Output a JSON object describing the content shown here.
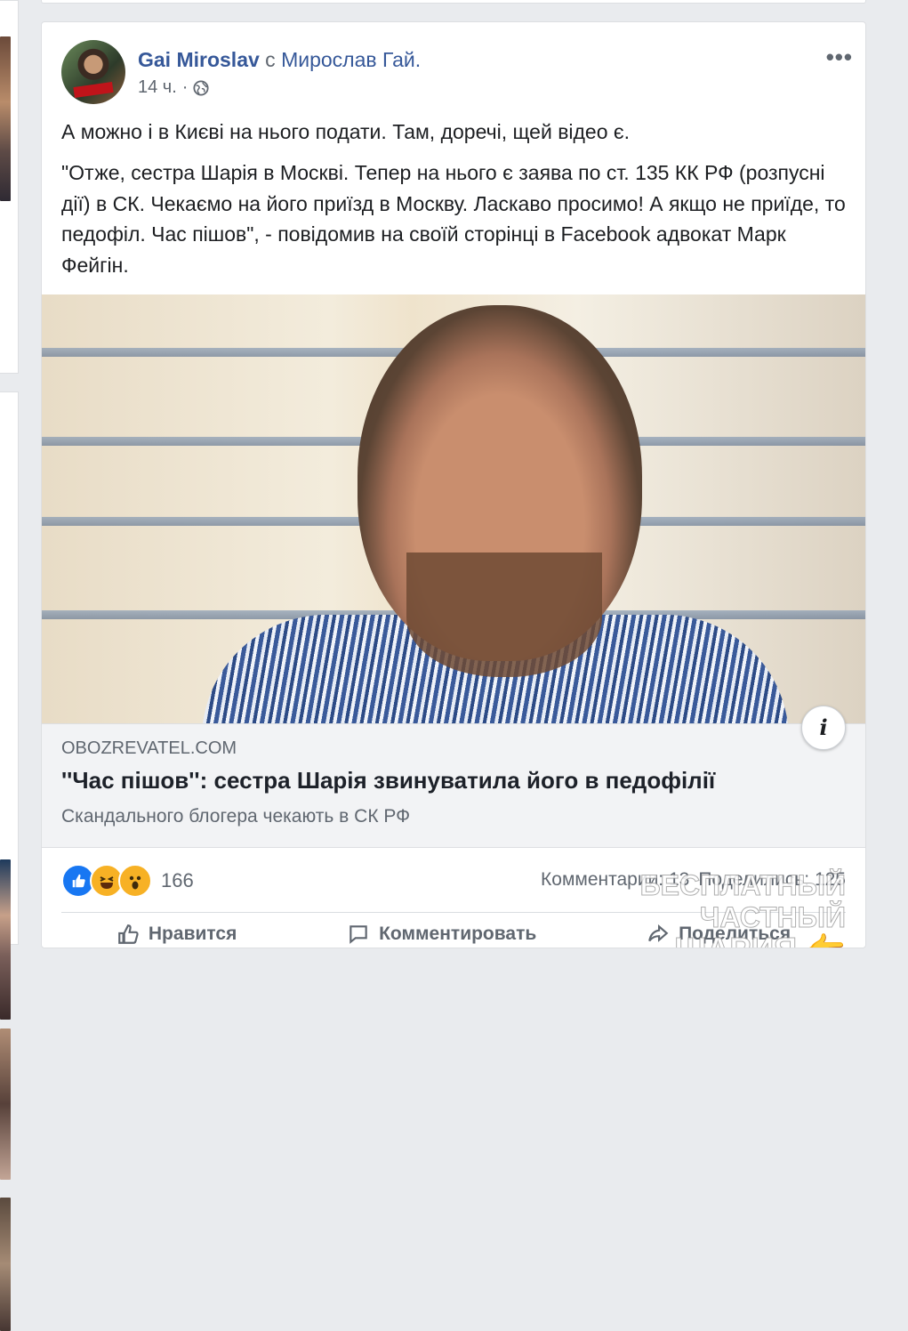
{
  "post": {
    "author": "Gai Miroslav",
    "with_label": "с",
    "with_name": "Мирослав Гай.",
    "time": "14 ч.",
    "dot": "·",
    "privacy_icon": "globe-icon",
    "more_label": "•••",
    "text_1": "А можно і в Києві на нього подати. Там, доречі, щей відео є.",
    "text_2": "\"Отже, сестра Шарія в Москві. Тепер на нього є заява по ст. 135 КК РФ (розпусні дії) в СК. Чекаємо на його приїзд в Москву. Ласкаво просимо! А якщо не приїде, то педофіл. Час пішов\", - повідомив на своїй сторінці в Facebook адвокат Марк Фейгін."
  },
  "link": {
    "info_label": "i",
    "domain": "OBOZREVATEL.COM",
    "title": "''Час пішов'': сестра Шарія звинуватила його в педофілії",
    "description": "Скандального блогера чекають в СК РФ"
  },
  "footer": {
    "reactions": [
      "like-icon",
      "haha-icon",
      "wow-icon"
    ],
    "reaction_count": "166",
    "comments": "Комментарии: 13",
    "shares": "Поделились: 125",
    "like_label": "Нравится",
    "comment_label": "Комментировать",
    "share_label": "Поделиться"
  },
  "watermark": {
    "line1": "БЕСПЛАТНЫЙ ЧАСТНЫЙ",
    "line2": "ШАРИЯ 👉 Sharij.net"
  },
  "colors": {
    "page_bg": "#e9ebee",
    "link_blue": "#365899",
    "like_blue": "#1877f2",
    "muted": "#606770"
  }
}
